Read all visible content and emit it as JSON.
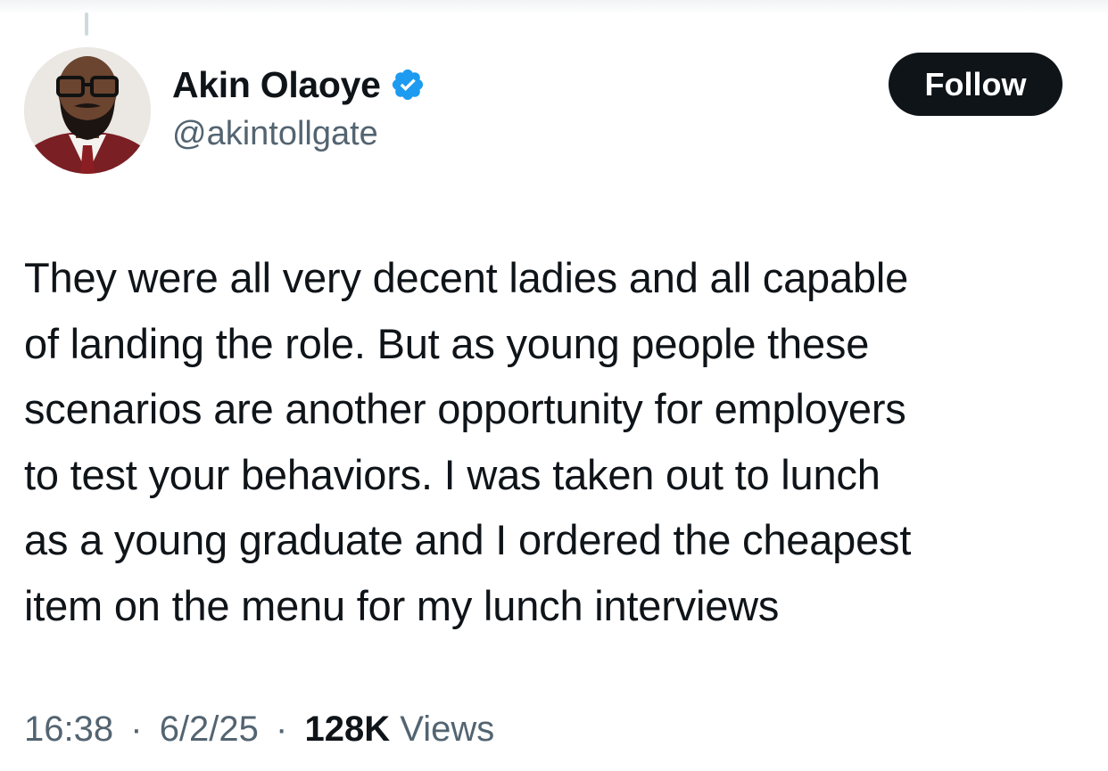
{
  "author": {
    "display_name": "Akin Olaoye",
    "handle": "@akintollgate",
    "verified": true,
    "verified_color": "#1d9bf0"
  },
  "actions": {
    "follow_label": "Follow"
  },
  "tweet": {
    "text": "They were all very decent ladies and all capable\nof landing the role. But as young people these\nscenarios are another opportunity for employers\nto test your behaviors. I was taken out to lunch\nas a young graduate and I ordered the cheapest\nitem on the menu for my lunch interviews"
  },
  "meta": {
    "time": "16:38",
    "separator": "·",
    "date": "6/2/25",
    "views_count": "128K",
    "views_label": "Views"
  },
  "icons": {
    "verified": "verified-badge-icon",
    "avatar": "avatar"
  }
}
